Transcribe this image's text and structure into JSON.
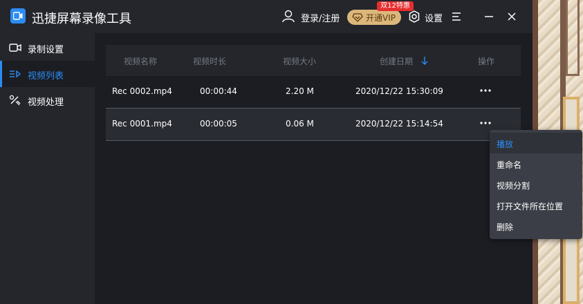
{
  "app": {
    "title": "迅捷屏幕录像工具"
  },
  "header": {
    "login_label": "登录/注册",
    "vip_label": "开通VIP",
    "vip_badge": "双12特惠",
    "settings_label": "设置"
  },
  "sidebar": {
    "items": [
      {
        "label": "录制设置",
        "icon": "camera-icon"
      },
      {
        "label": "视频列表",
        "icon": "list-icon",
        "active": true
      },
      {
        "label": "视频处理",
        "icon": "tools-icon"
      }
    ]
  },
  "table": {
    "headers": {
      "name": "视频名称",
      "duration": "视频时长",
      "size": "视频大小",
      "date": "创建日期",
      "actions": "操作"
    },
    "rows": [
      {
        "name": "Rec 0002.mp4",
        "duration": "00:00:44",
        "size": "2.20 M",
        "date": "2020/12/22 15:30:09"
      },
      {
        "name": "Rec 0001.mp4",
        "duration": "00:00:05",
        "size": "0.06 M",
        "date": "2020/12/22 15:14:54"
      }
    ]
  },
  "context_menu": {
    "items": [
      "播放",
      "重命名",
      "视频分割",
      "打开文件所在位置",
      "删除"
    ]
  },
  "colors": {
    "accent": "#2b8cf5",
    "vip": "#dcb77a",
    "badge": "#e62e2e"
  }
}
